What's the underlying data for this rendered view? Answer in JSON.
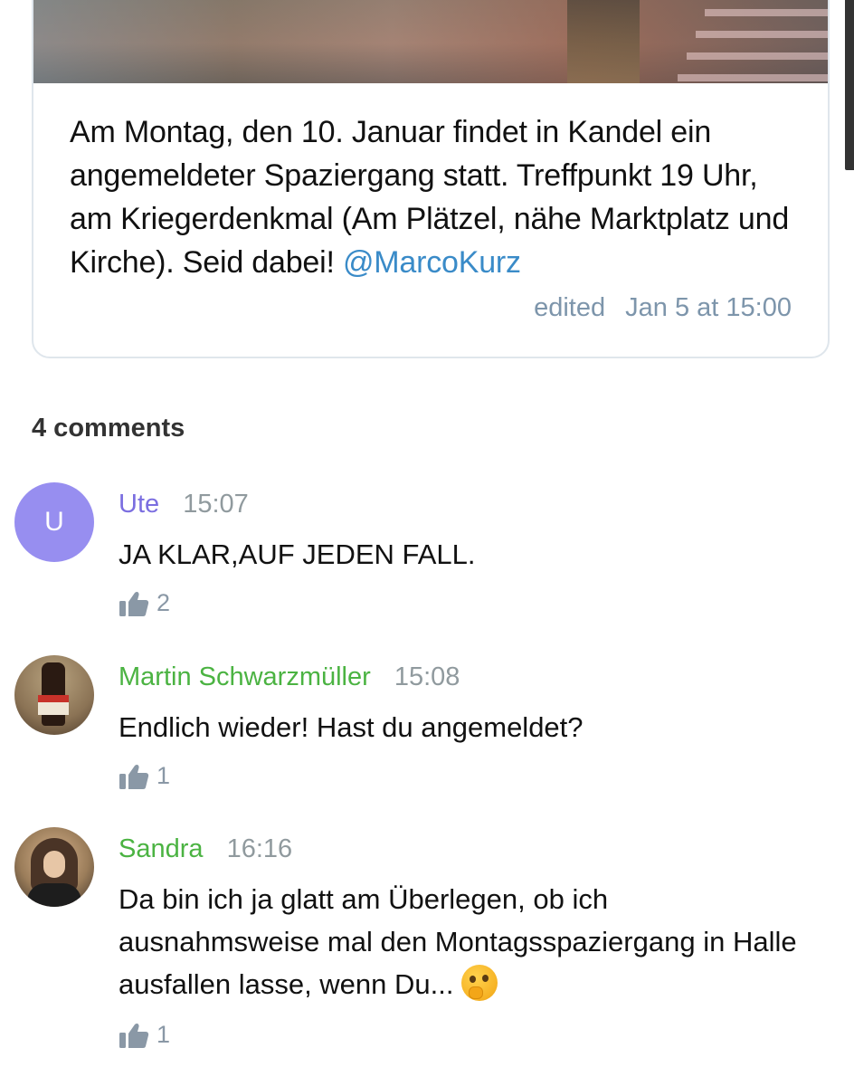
{
  "post": {
    "text": "Am Montag, den 10. Januar findet in Kandel ein angemeldeter Spaziergang statt. Treffpunkt 19 Uhr, am Kriegerdenkmal (Am Plätzel, nähe Marktplatz und Kirche). Seid dabei! ",
    "mention": "@MarcoKurz",
    "edited_label": "edited",
    "date": "Jan 5 at 15:00"
  },
  "comments_header": "4 comments",
  "comments": [
    {
      "avatar_letter": "U",
      "author": "Ute",
      "author_color": "#7b6ee0",
      "time": "15:07",
      "text": "JA KLAR,AUF JEDEN FALL.",
      "likes": "2"
    },
    {
      "author": "Martin Schwarzmüller",
      "author_color": "#4bb342",
      "time": "15:08",
      "text": "Endlich wieder! Hast du angemeldet?",
      "likes": "1"
    },
    {
      "author": "Sandra",
      "author_color": "#4bb342",
      "time": "16:16",
      "text": "Da bin ich ja glatt am Überlegen, ob ich ausnahmsweise mal den Montagsspaziergang in Halle ausfallen lasse, wenn Du... ",
      "emoji": "thinking-face",
      "likes": "1"
    }
  ],
  "colors": {
    "accent_link": "#3a8bc8",
    "meta_text": "#7d95ab",
    "avatar_bg": "#978ef0"
  }
}
